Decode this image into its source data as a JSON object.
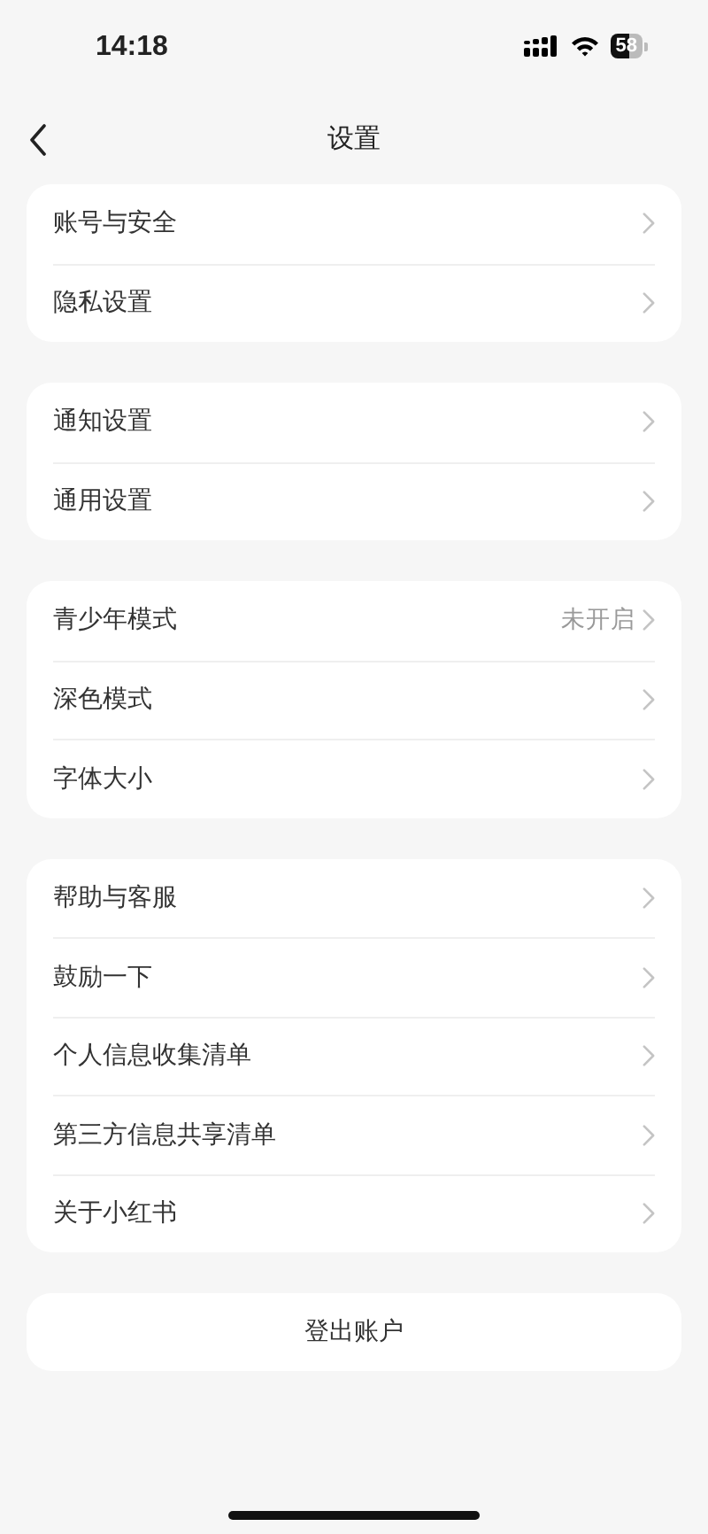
{
  "status_bar": {
    "time": "14:18",
    "battery": "58"
  },
  "nav": {
    "title": "设置"
  },
  "groups": [
    {
      "rows": [
        {
          "label": "账号与安全"
        },
        {
          "label": "隐私设置"
        }
      ]
    },
    {
      "rows": [
        {
          "label": "通知设置"
        },
        {
          "label": "通用设置"
        }
      ]
    },
    {
      "rows": [
        {
          "label": "青少年模式",
          "value": "未开启"
        },
        {
          "label": "深色模式"
        },
        {
          "label": "字体大小"
        }
      ]
    },
    {
      "rows": [
        {
          "label": "帮助与客服"
        },
        {
          "label": "鼓励一下"
        },
        {
          "label": "个人信息收集清单"
        },
        {
          "label": "第三方信息共享清单"
        },
        {
          "label": "关于小红书"
        }
      ]
    }
  ],
  "logout_button": "登出账户"
}
